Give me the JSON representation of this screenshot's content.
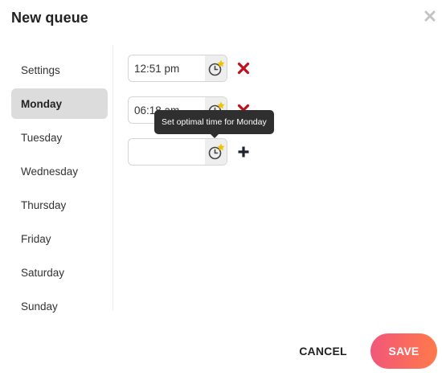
{
  "dialog": {
    "title": "New queue",
    "close_icon": "close-icon"
  },
  "sidebar": {
    "items": [
      {
        "label": "Settings",
        "active": false
      },
      {
        "label": "Monday",
        "active": true
      },
      {
        "label": "Tuesday",
        "active": false
      },
      {
        "label": "Wednesday",
        "active": false
      },
      {
        "label": "Thursday",
        "active": false
      },
      {
        "label": "Friday",
        "active": false
      },
      {
        "label": "Saturday",
        "active": false
      },
      {
        "label": "Sunday",
        "active": false
      }
    ]
  },
  "times": {
    "rows": [
      {
        "value": "12:51 pm",
        "action": "remove",
        "action_icon": "remove-x-icon"
      },
      {
        "value": "06:18 am",
        "action": "remove",
        "action_icon": "remove-x-icon"
      },
      {
        "value": "",
        "action": "add",
        "action_icon": "plus-icon"
      }
    ],
    "clock_icon": "clock-star-icon"
  },
  "tooltip": {
    "text": "Set optimal time for Monday"
  },
  "footer": {
    "cancel_label": "CANCEL",
    "save_label": "SAVE"
  },
  "colors": {
    "remove_red": "#c0101e",
    "plus_dark": "#1f2330",
    "star_yellow": "#f2c200",
    "save_gradient_start": "#f2567a",
    "save_gradient_end": "#ff7a4a",
    "tooltip_bg": "#2f2f2f"
  }
}
